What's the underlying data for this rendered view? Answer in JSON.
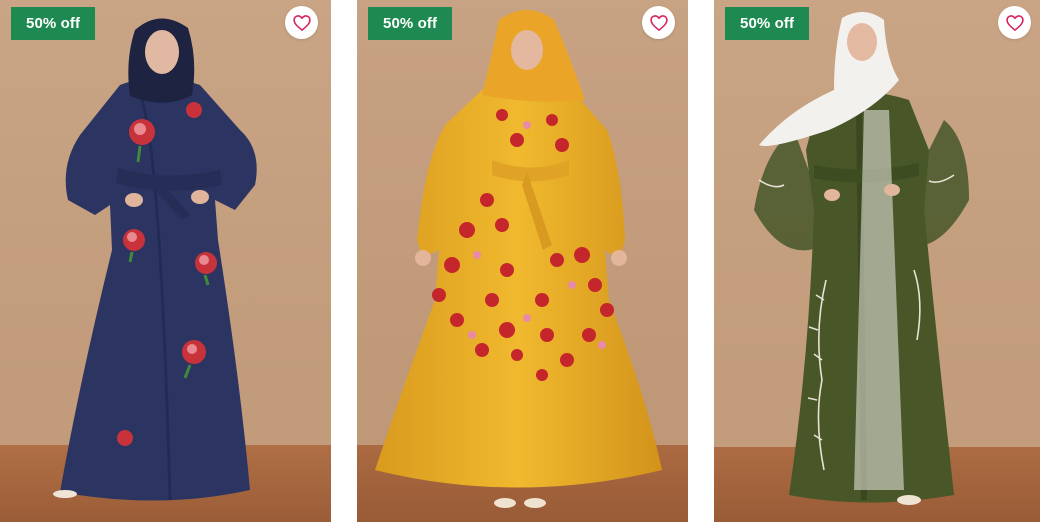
{
  "products": [
    {
      "discount_label": "50% off",
      "image_icon": "navy-floral-abaya-photo",
      "wishlist_icon": "heart-outline-icon"
    },
    {
      "discount_label": "50% off",
      "image_icon": "mustard-floral-abaya-photo",
      "wishlist_icon": "heart-outline-icon"
    },
    {
      "discount_label": "50% off",
      "image_icon": "olive-sheer-abaya-photo",
      "wishlist_icon": "heart-outline-icon"
    }
  ],
  "colors": {
    "badge_bg": "#1e8a52",
    "heart": "#d6245c",
    "backdrop": "#c59d7b",
    "floor": "#a8673f"
  }
}
